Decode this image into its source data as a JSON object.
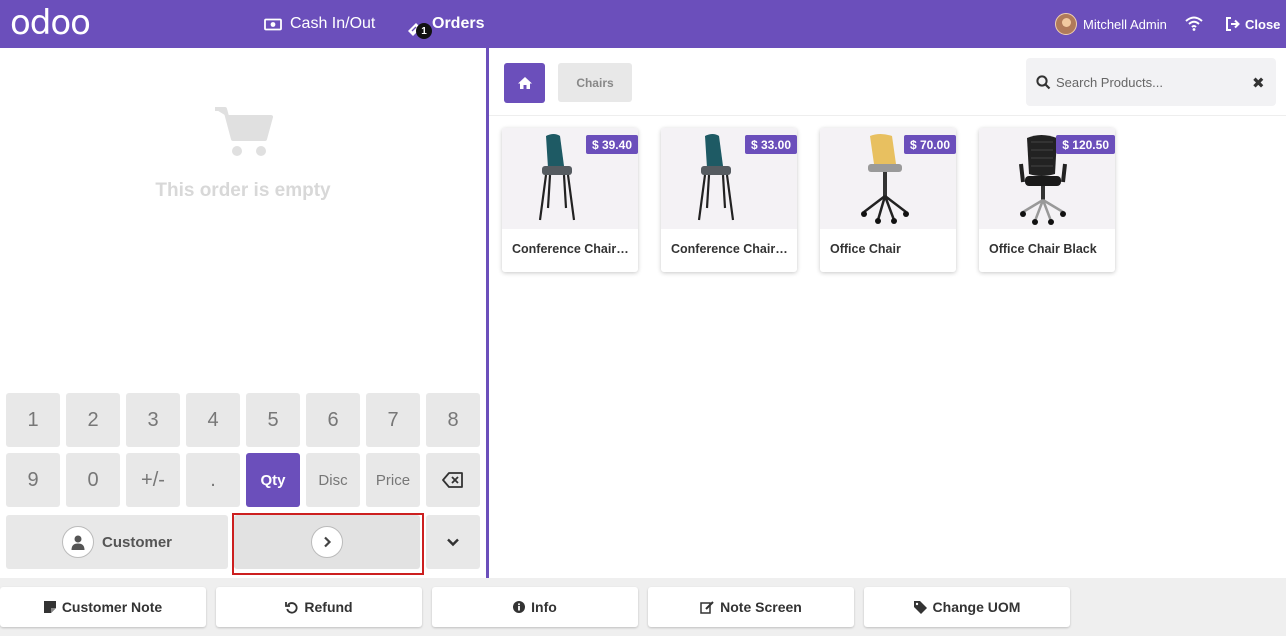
{
  "topbar": {
    "logo": "odoo",
    "cash_label": "Cash In/Out",
    "orders_label": "Orders",
    "orders_count": "1",
    "user_name": "Mitchell Admin",
    "close_label": "Close",
    "brand_color": "#6b4fbb"
  },
  "order": {
    "empty_text": "This order is empty"
  },
  "numpad": {
    "keys": [
      "1",
      "2",
      "3",
      "4",
      "5",
      "6",
      "7",
      "8",
      "9",
      "0",
      "+/-",
      ".",
      "Qty",
      "Disc",
      "Price"
    ],
    "active_mode": "Qty"
  },
  "actions": {
    "customer_label": "Customer"
  },
  "products_header": {
    "category": "Chairs",
    "search_placeholder": "Search Products..."
  },
  "products": [
    {
      "name": "Conference Chair (Steel)",
      "price": "$ 39.40",
      "seat_color": "#1e5a64"
    },
    {
      "name": "Conference Chair (Aluminium)",
      "price": "$ 33.00",
      "seat_color": "#1e5a64"
    },
    {
      "name": "Office Chair",
      "price": "$ 70.00",
      "seat_color": "#e8c060"
    },
    {
      "name": "Office Chair Black",
      "price": "$ 120.50",
      "seat_color": "#222222"
    }
  ],
  "control_buttons": [
    {
      "label": "Customer Note",
      "icon": "sticky-note-icon"
    },
    {
      "label": "Refund",
      "icon": "undo-icon"
    },
    {
      "label": "Info",
      "icon": "info-icon"
    },
    {
      "label": "Note Screen",
      "icon": "edit-icon"
    },
    {
      "label": "Change UOM",
      "icon": "tag-icon"
    }
  ]
}
